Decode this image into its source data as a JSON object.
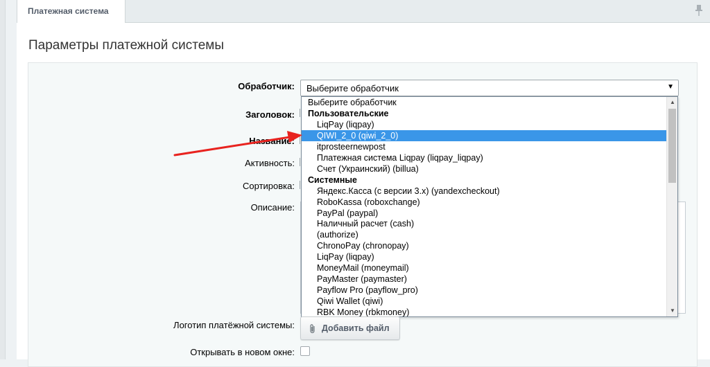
{
  "tab": {
    "label": "Платежная система"
  },
  "panel": {
    "title": "Параметры платежной системы"
  },
  "form": {
    "handler_label": "Обработчик:",
    "header_label": "Заголовок:",
    "name_label": "Название:",
    "active_label": "Активность:",
    "sort_label": "Сортировка:",
    "description_label": "Описание:",
    "logo_label": "Логотип платёжной системы:",
    "new_window_label": "Открывать в новом окне:",
    "add_file_label": "Добавить файл",
    "handler_value": "Выберите обработчик"
  },
  "dropdown": {
    "selected_index": 2,
    "options": [
      {
        "text": "Выберите обработчик",
        "kind": "top"
      },
      {
        "text": "Пользовательские",
        "kind": "group"
      },
      {
        "text": "LiqPay (liqpay)",
        "kind": "item"
      },
      {
        "text": "QIWI_2_0 (qiwi_2_0)",
        "kind": "item"
      },
      {
        "text": "itprosteernewpost",
        "kind": "item"
      },
      {
        "text": "Платежная система Liqpay (liqpay_liqpay)",
        "kind": "item"
      },
      {
        "text": "Счет (Украинский) (billua)",
        "kind": "item"
      },
      {
        "text": "Системные",
        "kind": "group"
      },
      {
        "text": "Яндекс.Касса (с версии 3.x) (yandexcheckout)",
        "kind": "item"
      },
      {
        "text": "RoboKassa (roboxchange)",
        "kind": "item"
      },
      {
        "text": "PayPal (paypal)",
        "kind": "item"
      },
      {
        "text": "Наличный расчет (cash)",
        "kind": "item"
      },
      {
        "text": "(authorize)",
        "kind": "item"
      },
      {
        "text": "ChronoPay (chronopay)",
        "kind": "item"
      },
      {
        "text": "LiqPay (liqpay)",
        "kind": "item"
      },
      {
        "text": "MoneyMail (moneymail)",
        "kind": "item"
      },
      {
        "text": "PayMaster (paymaster)",
        "kind": "item"
      },
      {
        "text": "Payflow Pro (payflow_pro)",
        "kind": "item"
      },
      {
        "text": "Qiwi Wallet (qiwi)",
        "kind": "item"
      },
      {
        "text": "RBK Money (rbkmoney)",
        "kind": "item"
      }
    ]
  },
  "icons": {
    "pin": "pin-icon",
    "clip": "paperclip-icon",
    "arrow": "red-arrow-annotation"
  },
  "colors": {
    "selection": "#3a96e8",
    "arrow": "#e8231f",
    "button_text": "#535c69"
  }
}
